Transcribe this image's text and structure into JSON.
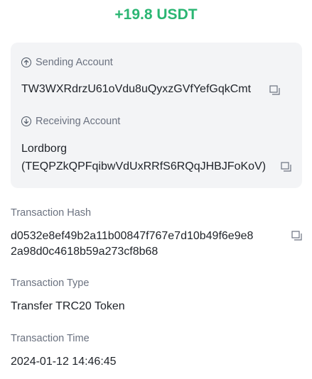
{
  "amount": "+19.8 USDT",
  "sending": {
    "label": "Sending Account",
    "address": "TW3WXRdrzU61oVdu8uQyxzGVfYefGqkCmt"
  },
  "receiving": {
    "label": "Receiving Account",
    "name": "Lordborg",
    "address": "(TEQPZkQPFqibwVdUxRRfS6RQqJHBJFoKoV)"
  },
  "hash": {
    "label": "Transaction Hash",
    "line1": "d0532e8ef49b2a11b00847f767e7d10b49f6e9e8",
    "line2": "2a98d0c4618b59a273cf8b68"
  },
  "type": {
    "label": "Transaction Type",
    "value": "Transfer TRC20 Token"
  },
  "time": {
    "label": "Transaction Time",
    "value": "2024-01-12 14:46:45"
  },
  "icons": {
    "sending": "arrow-up-circle-icon",
    "receiving": "arrow-down-circle-icon",
    "copy": "copy-icon"
  },
  "colors": {
    "amount": "#2bb673",
    "card_bg": "#f3f4f6",
    "label": "#6b7280"
  }
}
